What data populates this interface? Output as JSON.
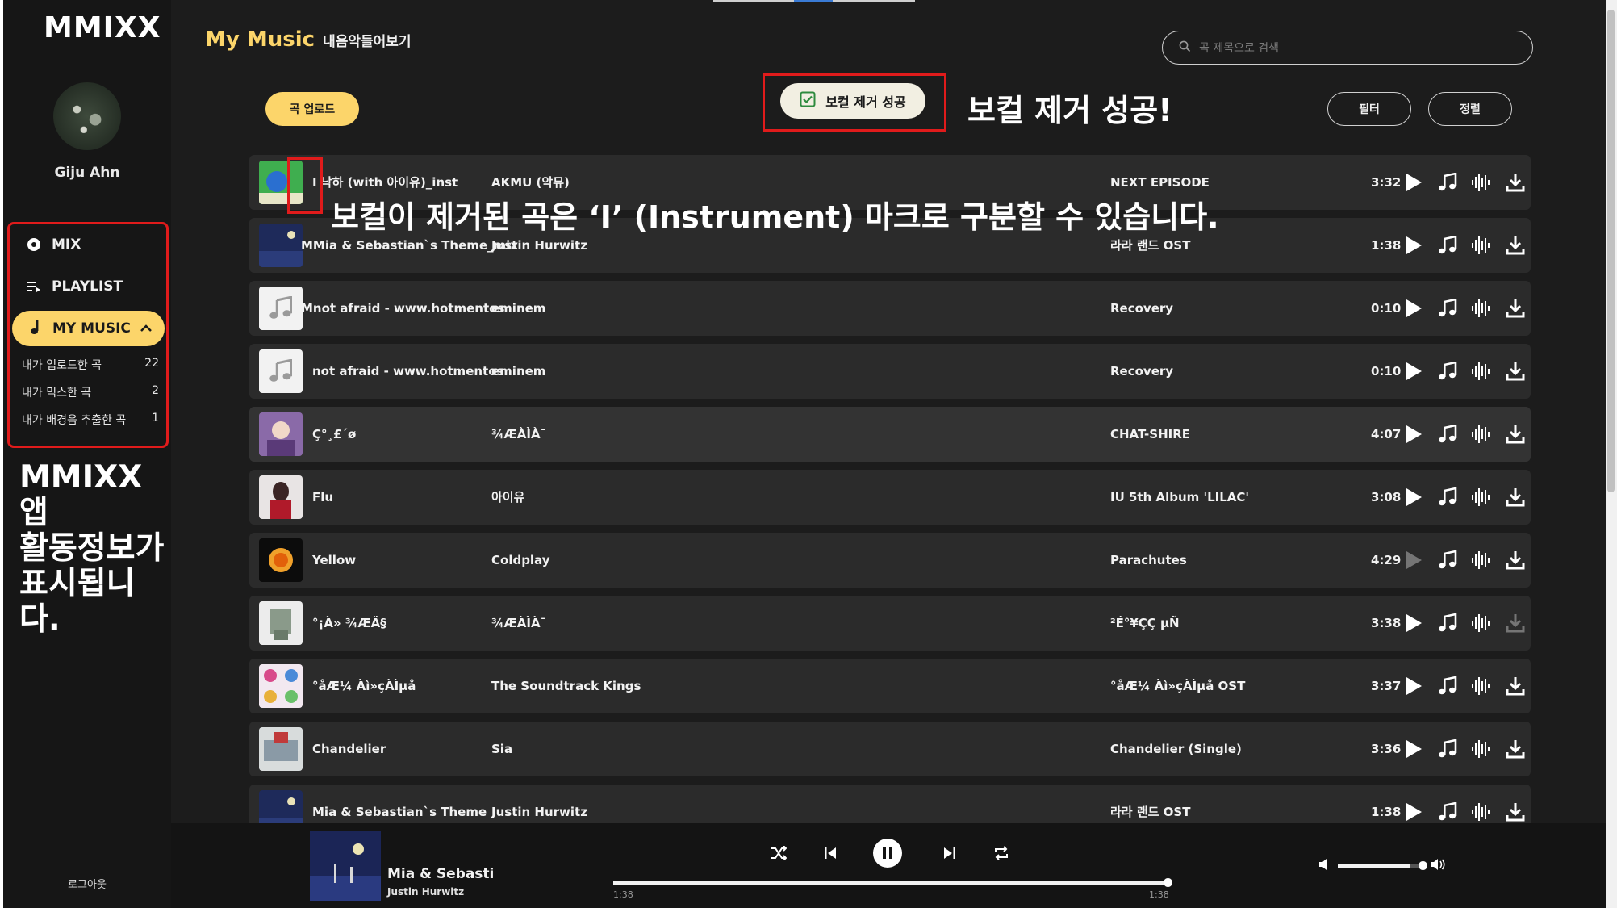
{
  "sidebar": {
    "logo": "MMIXX",
    "username": "Giju Ahn",
    "nav": {
      "mix": "MIX",
      "playlist": "PLAYLIST",
      "my_music": "MY MUSIC"
    },
    "sub_items": [
      {
        "label": "내가 업로드한 곡",
        "count": "22"
      },
      {
        "label": "내가 믹스한 곡",
        "count": "2"
      },
      {
        "label": "내가 배경음 추출한 곡",
        "count": "1"
      }
    ],
    "logout": "로그아웃"
  },
  "annotations": {
    "side_line1": "MMIXX 앱",
    "side_line2": "활동정보가",
    "side_line3": "표시됩니다.",
    "success": "보컬 제거 성공!",
    "instrument": "보컬이 제거된 곡은 ‘I’ (Instrument) 마크로 구분할 수 있습니다."
  },
  "header": {
    "title": "My Music",
    "subtitle": "내음악들어보기",
    "search_placeholder": "곡 제목으로 검색",
    "upload_button": "곡 업로드",
    "success_toast": "보컬 제거 성공",
    "filter_button": "필터",
    "sort_button": "정렬"
  },
  "songs": [
    {
      "title": "I 낙하 (with 아이유)_inst",
      "artist": "AKMU (악뮤)",
      "album": "NEXT EPISODE",
      "duration": "3:32"
    },
    {
      "title": "MMia & Sebastian`s Theme_mix",
      "artist": "Justin Hurwitz",
      "album": "라라 랜드 OST",
      "duration": "1:38"
    },
    {
      "title": "Mnot afraid - www.hotmentos",
      "artist": "eminem",
      "album": "Recovery",
      "duration": "0:10"
    },
    {
      "title": "not afraid - www.hotmentos",
      "artist": "eminem",
      "album": "Recovery",
      "duration": "0:10"
    },
    {
      "title": "Ç°¸£´ø",
      "artist": "¾ÆÀÌÀ¯",
      "album": "CHAT-SHIRE",
      "duration": "4:07"
    },
    {
      "title": "Flu",
      "artist": "아이유",
      "album": "IU 5th Album 'LILAC'",
      "duration": "3:08"
    },
    {
      "title": "Yellow",
      "artist": "Coldplay",
      "album": "Parachutes",
      "duration": "4:29"
    },
    {
      "title": "°¡À» ¾ÆÄ§",
      "artist": "¾ÆÀÌÀ¯",
      "album": "²É°¥ÇÇ µÑ",
      "duration": "3:38"
    },
    {
      "title": "°åÆ¼ Àì»çÀÌµå",
      "artist": "The Soundtrack Kings",
      "album": "°åÆ¼ Àì»çÀÌµå OST",
      "duration": "3:37"
    },
    {
      "title": "Chandelier",
      "artist": "Sia",
      "album": "Chandelier (Single)",
      "duration": "3:36"
    },
    {
      "title": "Mia & Sebastian`s Theme",
      "artist": "Justin Hurwitz",
      "album": "라라 랜드 OST",
      "duration": "1:38"
    }
  ],
  "player": {
    "title": "Mia & Sebastian's Theme",
    "artist": "Justin Hurwitz",
    "elapsed": "1:38",
    "total": "1:38",
    "progress": 1.0,
    "volume": 0.85
  },
  "colors": {
    "accent": "#fcd56a",
    "annotation_red": "#e01b1b",
    "background": "#1c1c1c",
    "row": "#2b2b2b"
  }
}
